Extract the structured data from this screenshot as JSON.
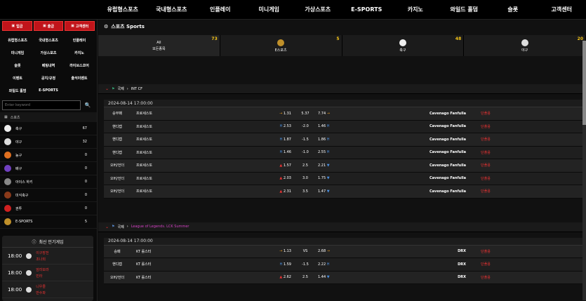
{
  "topnav": [
    "유럽형스포츠",
    "국내형스포츠",
    "인플레이",
    "미니게임",
    "가상스포츠",
    "E-SPORTS",
    "카지노",
    "와일드 홀덤",
    "슬롯",
    "고객센터"
  ],
  "side_buttons": [
    {
      "icon": "deposit-icon",
      "label": "입금"
    },
    {
      "icon": "withdraw-icon",
      "label": "출금"
    },
    {
      "icon": "support-icon",
      "label": "고객센터"
    }
  ],
  "side_menu": [
    "유럽형스포츠",
    "국내형스포츠",
    "인플레이",
    "미니게임",
    "가상스포츠",
    "카지노",
    "슬롯",
    "베팅내역",
    "라이브스코어",
    "이벤트",
    "공지/규정",
    "출석이벤트",
    "와일드 홀덤",
    "E-SPORTS",
    ""
  ],
  "search": {
    "placeholder": "Enter keyword"
  },
  "sidebar_head": "스포츠",
  "sports": [
    {
      "name": "축구",
      "count": "67",
      "color": "#eeeeee"
    },
    {
      "name": "야구",
      "count": "32",
      "color": "#dddddd"
    },
    {
      "name": "농구",
      "count": "0",
      "color": "#e07020"
    },
    {
      "name": "배구",
      "count": "0",
      "color": "#7040c0"
    },
    {
      "name": "아이스 하키",
      "count": "0",
      "color": "#888888"
    },
    {
      "name": "미식축구",
      "count": "0",
      "color": "#8a3a1a"
    },
    {
      "name": "권투",
      "count": "0",
      "color": "#d02020"
    },
    {
      "name": "E-SPORTS",
      "count": "5",
      "color": "#c0902a"
    }
  ],
  "popular": {
    "title": "최신 인기게임",
    "rows": [
      {
        "time": "18:00",
        "team1": "이구장전",
        "team2": "조나외"
      },
      {
        "time": "18:00",
        "team1": "암라모라",
        "team2": "민라"
      },
      {
        "time": "18:00",
        "team1": "니우즐",
        "team2": "반수파"
      }
    ]
  },
  "page_title": "스포츠 Sports",
  "tabs": [
    {
      "label": "모든종목",
      "count": "73",
      "icon": "all-icon",
      "top": "All"
    },
    {
      "label": "E스포츠",
      "count": "5",
      "icon": "esports-icon",
      "top": ""
    },
    {
      "label": "축구",
      "count": "48",
      "icon": "soccer-icon",
      "top": ""
    },
    {
      "label": "야구",
      "count": "20",
      "icon": "baseball-icon",
      "top": ""
    }
  ],
  "league1": {
    "country": "국제",
    "name": "INT CF"
  },
  "block1": {
    "date": "2024-08-14 17:00:00",
    "rows": [
      {
        "type": "승무패",
        "home": "프로세스또",
        "odd1": "1.31",
        "mid": "5.37",
        "odd2": "7.74",
        "away": "Cavenago Fanfulla",
        "more": "단폴용",
        "dir1": "gold",
        "dir2": "gold"
      },
      {
        "type": "핸디캡",
        "home": "프로세스또",
        "odd1": "2.53",
        "mid": "-2.0",
        "odd2": "1.46",
        "away": "Cavenago Fanfulla",
        "more": "단폴용",
        "dir1": "H",
        "dir2": "H"
      },
      {
        "type": "핸디캡",
        "home": "프로세스또",
        "odd1": "1.87",
        "mid": "-1.5",
        "odd2": "1.86",
        "away": "Cavenago Fanfulla",
        "more": "단폴용",
        "dir1": "H",
        "dir2": "H"
      },
      {
        "type": "핸디캡",
        "home": "프로세스또",
        "odd1": "1.46",
        "mid": "-1.0",
        "odd2": "2.55",
        "away": "Cavenago Fanfulla",
        "more": "단폴용",
        "dir1": "H",
        "dir2": "H"
      },
      {
        "type": "오버/언더",
        "home": "프로세스또",
        "odd1": "1.57",
        "mid": "2.5",
        "odd2": "2.21",
        "away": "Cavenago Fanfulla",
        "more": "단폴용",
        "dir1": "up",
        "dir2": "down"
      },
      {
        "type": "오버/언더",
        "home": "프로세스또",
        "odd1": "2.03",
        "mid": "3.0",
        "odd2": "1.75",
        "away": "Cavenago Fanfulla",
        "more": "단폴용",
        "dir1": "up",
        "dir2": "down"
      },
      {
        "type": "오버/언더",
        "home": "프로세스또",
        "odd1": "2.31",
        "mid": "3.5",
        "odd2": "1.47",
        "away": "Cavenago Fanfulla",
        "more": "단폴용",
        "dir1": "up",
        "dir2": "down"
      }
    ]
  },
  "league2": {
    "country": "국제",
    "name": "League of Legends. LCK Summer"
  },
  "block2": {
    "date": "2024-08-14 17:00:00",
    "rows": [
      {
        "type": "승패",
        "home": "KT 롤스터",
        "odd1": "1.13",
        "mid": "VS",
        "odd2": "2.68",
        "away": "DRX",
        "more": "단폴용",
        "dir1": "gold",
        "dir2": "gold"
      },
      {
        "type": "핸디캡",
        "home": "KT 롤스터",
        "odd1": "1.59",
        "mid": "-1.5",
        "odd2": "2.22",
        "away": "DRX",
        "more": "단폴용",
        "dir1": "H",
        "dir2": "H"
      },
      {
        "type": "오버/언더",
        "home": "KT 롤스터",
        "odd1": "2.62",
        "mid": "2.5",
        "odd2": "1.44",
        "away": "DRX",
        "more": "단폴용",
        "dir1": "up",
        "dir2": "down"
      }
    ]
  }
}
